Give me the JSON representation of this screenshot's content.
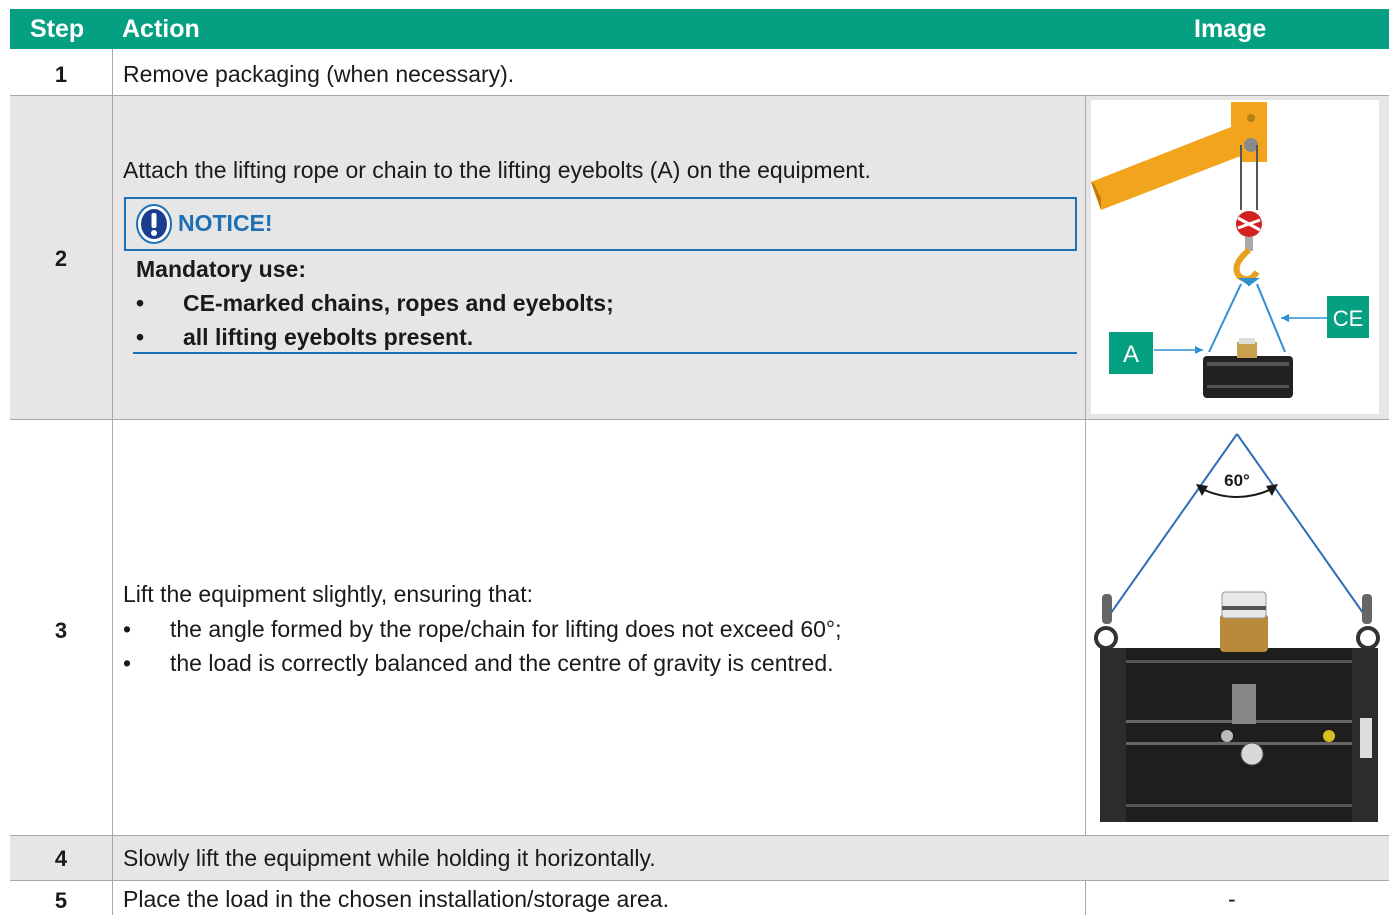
{
  "header": {
    "step": "Step",
    "action": "Action",
    "image": "Image"
  },
  "rows": [
    {
      "step": "1",
      "action": "Remove packaging (when necessary)."
    },
    {
      "step": "2",
      "action": "Attach the lifting rope or chain to the lifting eyebolts (A) on the equipment.",
      "notice": {
        "title": "NOTICE!",
        "lead": "Mandatory use:",
        "bullets": [
          "CE-marked chains, ropes and eyebolts;",
          "all lifting eyebolts present."
        ]
      },
      "figure": {
        "label_a": "A",
        "label_ce": "CE"
      }
    },
    {
      "step": "3",
      "action": "Lift the equipment slightly, ensuring that:",
      "bullets": [
        "the angle formed by the rope/chain for lifting does not exceed 60°;",
        "the load is correctly balanced and the centre of gravity is centred."
      ],
      "figure": {
        "angle_label": "60°"
      }
    },
    {
      "step": "4",
      "action": "Slowly lift the equipment while holding it horizontally."
    },
    {
      "step": "5",
      "action": "Place the load in the chosen installation/storage area.",
      "image": "-"
    }
  ],
  "colors": {
    "header": "#05a082",
    "notice": "#1f6fb4",
    "crane": "#f2a51c",
    "rope": "#2f8fd0"
  }
}
